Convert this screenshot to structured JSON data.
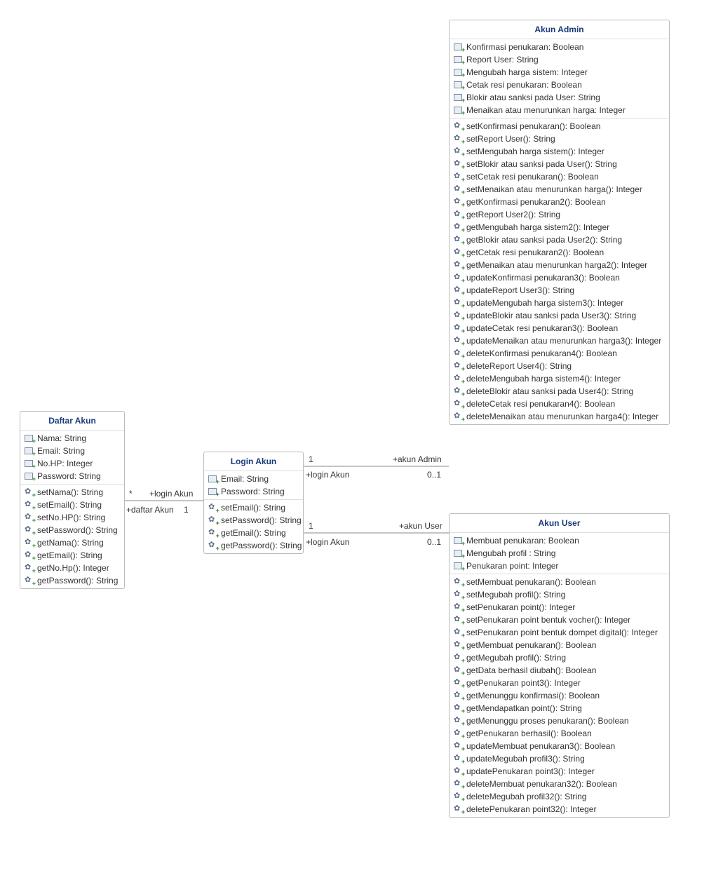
{
  "classes": {
    "daftarAkun": {
      "title": "Daftar Akun",
      "attributes": [
        "Nama: String",
        "Email: String",
        "No.HP: Integer",
        "Password: String"
      ],
      "operations": [
        "setNama(): String",
        "setEmail(): String",
        "setNo.HP(): String",
        "setPassword(): String",
        "getNama(): String",
        "getEmail(): String",
        "getNo.Hp(): Integer",
        "getPassword(): String"
      ]
    },
    "loginAkun": {
      "title": "Login Akun",
      "attributes": [
        "Email: String",
        "Password: String"
      ],
      "operations": [
        "setEmail(): String",
        "setPassword(): String",
        "getEmail(): String",
        "getPassword(): String"
      ]
    },
    "akunAdmin": {
      "title": "Akun Admin",
      "attributes": [
        "Konfirmasi penukaran: Boolean",
        "Report User: String",
        "Mengubah harga sistem: Integer",
        "Cetak resi penukaran: Boolean",
        "Blokir atau sanksi pada User: String",
        "Menaikan atau menurunkan harga: Integer"
      ],
      "operations": [
        "setKonfirmasi penukaran(): Boolean",
        "setReport User(): String",
        "setMengubah harga sistem(): Integer",
        "setBlokir atau sanksi pada User(): String",
        "setCetak resi penukaran(): Boolean",
        "setMenaikan atau menurunkan harga(): Integer",
        "getKonfirmasi penukaran2(): Boolean",
        "getReport User2(): String",
        "getMengubah harga sistem2(): Integer",
        "getBlokir atau sanksi pada User2(): String",
        "getCetak resi penukaran2(): Boolean",
        "getMenaikan atau menurunkan harga2(): Integer",
        "updateKonfirmasi penukaran3(): Boolean",
        "updateReport User3(): String",
        "updateMengubah harga sistem3(): Integer",
        "updateBlokir atau sanksi pada User3(): String",
        "updateCetak resi penukaran3(): Boolean",
        "updateMenaikan atau menurunkan harga3(): Integer",
        "deleteKonfirmasi penukaran4(): Boolean",
        "deleteReport User4(): String",
        "deleteMengubah harga sistem4(): Integer",
        "deleteBlokir atau sanksi pada User4(): String",
        "deleteCetak resi penukaran4(): Boolean",
        "deleteMenaikan atau menurunkan harga4(): Integer"
      ]
    },
    "akunUser": {
      "title": "Akun User",
      "attributes": [
        "Membuat penukaran: Boolean",
        "Mengubah profil : String",
        "Penukaran point: Integer"
      ],
      "operations": [
        "setMembuat penukaran(): Boolean",
        "setMegubah profil(): String",
        "setPenukaran point(): Integer",
        "setPenukaran point bentuk vocher(): Integer",
        "setPenukaran point bentuk dompet digital(): Integer",
        "getMembuat penukaran(): Boolean",
        "getMegubah profil(): String",
        "getData berhasil diubah(): Boolean",
        "getPenukaran point3(): Integer",
        "getMenunggu konfirmasi(): Boolean",
        "getMendapatkan point(): String",
        "getMenunggu proses penukaran(): Boolean",
        "getPenukaran berhasil(): Boolean",
        "updateMembuat penukaran3(): Boolean",
        "updateMegubah profil3(): String",
        "updatePenukaran point3(): Integer",
        "deleteMembuat penukaran32(): Boolean",
        "deleteMegubah profil32(): String",
        "deletePenukaran point32(): Integer"
      ]
    }
  },
  "labels": {
    "daftar_login_left_mult": "*",
    "daftar_login_left_role": "+login Akun",
    "daftar_login_right_role": "+daftar Akun",
    "daftar_login_right_mult": "1",
    "login_admin_left_mult": "1",
    "login_admin_right_role": "+akun Admin",
    "login_admin_bottom_left_role": "+login Akun",
    "login_admin_bottom_right_mult": "0..1",
    "login_user_left_mult": "1",
    "login_user_right_role": "+akun User",
    "login_user_bottom_left_role": "+login Akun",
    "login_user_bottom_right_mult": "0..1"
  }
}
